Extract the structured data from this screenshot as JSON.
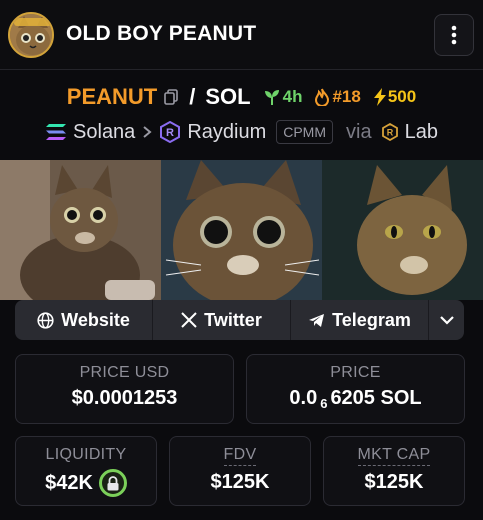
{
  "header": {
    "title": "OLD BOY PEANUT",
    "avatar_icon": "cat-avatar-icon",
    "menu_icon": "kebab-menu-icon"
  },
  "pair": {
    "base": "PEANUT",
    "separator": "/",
    "quote": "SOL",
    "age": "4h",
    "rank": "#18",
    "boosts": "500",
    "colors": {
      "base": "#f39b2a",
      "age": "#6fd36a",
      "boosts": "#f5c518"
    }
  },
  "chain": {
    "chain_name": "Solana",
    "dex_name": "Raydium",
    "pool_type": "CPMM",
    "via_label": "via",
    "launchpad": "Lab"
  },
  "links": {
    "website": "Website",
    "twitter": "Twitter",
    "telegram": "Telegram"
  },
  "stats": {
    "price_usd_label": "PRICE USD",
    "price_usd_value": "$0.0001253",
    "price_label": "PRICE",
    "price_prefix": "0.0",
    "price_zero_count": "6",
    "price_digits": "6205 SOL",
    "liquidity_label": "LIQUIDITY",
    "liquidity_value": "$42K",
    "fdv_label": "FDV",
    "fdv_value": "$125K",
    "mktcap_label": "MKT CAP",
    "mktcap_value": "$125K"
  }
}
